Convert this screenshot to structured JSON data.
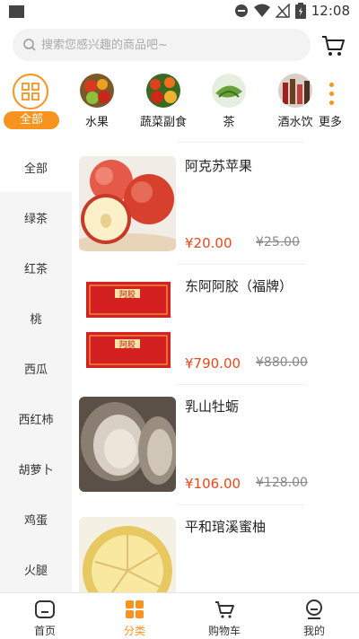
{
  "status_bar": {
    "time": "12:08"
  },
  "search": {
    "placeholder": "搜索您感兴趣的商品吧~"
  },
  "categories": [
    {
      "label": "全部",
      "icon": "grid-icon"
    },
    {
      "label": "水果",
      "icon": "fruit-photo"
    },
    {
      "label": "蔬菜副食",
      "icon": "vegetable-photo"
    },
    {
      "label": "茶",
      "icon": "tea-photo"
    },
    {
      "label": "酒水饮",
      "icon": "drinks-photo"
    },
    {
      "label": "更多",
      "icon": "more-dots-icon"
    }
  ],
  "sidebar": {
    "items": [
      {
        "label": "全部"
      },
      {
        "label": "绿茶"
      },
      {
        "label": "红茶"
      },
      {
        "label": "桃"
      },
      {
        "label": "西瓜"
      },
      {
        "label": "西红柿"
      },
      {
        "label": "胡萝卜"
      },
      {
        "label": "鸡蛋"
      },
      {
        "label": "火腿"
      }
    ]
  },
  "products": [
    {
      "name": "阿克苏苹果",
      "price": "¥20.00",
      "old_price": "¥25.00"
    },
    {
      "name": "东阿阿胶（福牌）",
      "price": "¥790.00",
      "old_price": "¥880.00"
    },
    {
      "name": "乳山牡蛎",
      "price": "¥106.00",
      "old_price": "¥128.00"
    },
    {
      "name": "平和琯溪蜜柚",
      "price": "",
      "old_price": ""
    }
  ],
  "product_image_text": {
    "ejiao": "阿胶"
  },
  "bottom_nav": [
    {
      "label": "首页",
      "icon": "home-icon"
    },
    {
      "label": "分类",
      "icon": "category-icon"
    },
    {
      "label": "购物车",
      "icon": "cart-icon"
    },
    {
      "label": "我的",
      "icon": "profile-icon"
    }
  ],
  "colors": {
    "accent": "#f7931e",
    "price": "#e8481c",
    "sidebar_bg": "#f5f5f5"
  }
}
